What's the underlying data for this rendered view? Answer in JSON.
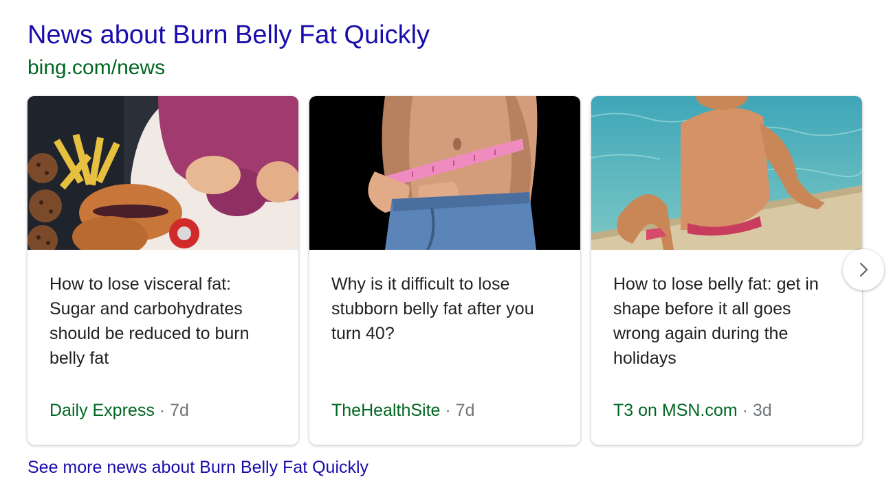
{
  "header": {
    "title": "News about Burn Belly Fat Quickly",
    "source": "bing.com/news"
  },
  "cards": [
    {
      "headline": "How to lose visceral fat: Sugar and carbohydrates should be reduced to burn belly fat",
      "publisher": "Daily Express",
      "separator": "·",
      "age": "7d"
    },
    {
      "headline": "Why is it difficult to lose stubborn belly fat after you turn 40?",
      "publisher": "TheHealthSite",
      "separator": "·",
      "age": "7d"
    },
    {
      "headline": "How to lose belly fat: get in shape before it all goes wrong again during the holidays",
      "publisher": "T3 on MSN.com",
      "separator": "·",
      "age": "3d"
    }
  ],
  "see_more": "See more news about Burn Belly Fat Quickly",
  "icons": {
    "next": "chevron-right-icon"
  },
  "colors": {
    "link": "#1a0dab",
    "source": "#006621",
    "muted": "#70757a",
    "text": "#202124"
  }
}
